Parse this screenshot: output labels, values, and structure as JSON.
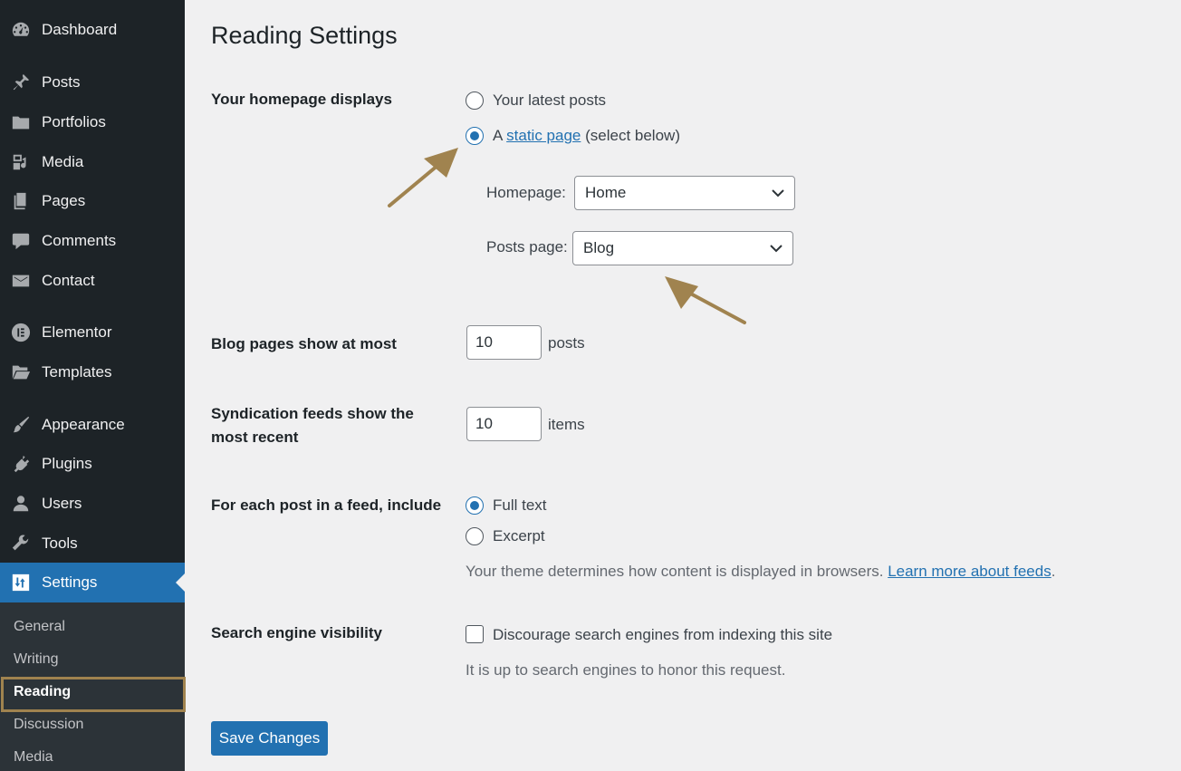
{
  "sidebar": {
    "items": [
      {
        "label": "Dashboard",
        "icon": "dashboard-icon"
      },
      {
        "label": "Posts",
        "icon": "pushpin-icon"
      },
      {
        "label": "Portfolios",
        "icon": "folder-icon"
      },
      {
        "label": "Media",
        "icon": "media-icon"
      },
      {
        "label": "Pages",
        "icon": "pages-icon"
      },
      {
        "label": "Comments",
        "icon": "comment-icon"
      },
      {
        "label": "Contact",
        "icon": "envelope-icon"
      },
      {
        "label": "Elementor",
        "icon": "elementor-icon"
      },
      {
        "label": "Templates",
        "icon": "folder-open-icon"
      },
      {
        "label": "Appearance",
        "icon": "paintbrush-icon"
      },
      {
        "label": "Plugins",
        "icon": "plug-icon"
      },
      {
        "label": "Users",
        "icon": "user-icon"
      },
      {
        "label": "Tools",
        "icon": "wrench-icon"
      },
      {
        "label": "Settings",
        "icon": "settings-icon",
        "active": true
      }
    ],
    "submenu": [
      {
        "label": "General"
      },
      {
        "label": "Writing"
      },
      {
        "label": "Reading",
        "current": true
      },
      {
        "label": "Discussion"
      },
      {
        "label": "Media"
      }
    ]
  },
  "page": {
    "title": "Reading Settings",
    "homepage_displays": {
      "label": "Your homepage displays",
      "option_latest": "Your latest posts",
      "option_static_prefix": "A",
      "option_static_link": "static page",
      "option_static_suffix": "(select below)",
      "selected": "static",
      "homepage_label": "Homepage:",
      "homepage_value": "Home",
      "posts_page_label": "Posts page:",
      "posts_page_value": "Blog"
    },
    "blog_pages": {
      "label": "Blog pages show at most",
      "value": "10",
      "unit": "posts"
    },
    "syndication": {
      "label_line1": "Syndication feeds show the",
      "label_line2": "most recent",
      "value": "10",
      "unit": "items"
    },
    "feed_content": {
      "label": "For each post in a feed, include",
      "option_full": "Full text",
      "option_excerpt": "Excerpt",
      "selected": "full",
      "description": "Your theme determines how content is displayed in browsers.",
      "link": "Learn more about feeds",
      "link_suffix": "."
    },
    "search_visibility": {
      "label": "Search engine visibility",
      "checkbox_label": "Discourage search engines from indexing this site",
      "checked": false,
      "description": "It is up to search engines to honor this request."
    },
    "save_label": "Save Changes"
  },
  "colors": {
    "sidebar_bg": "#1d2327",
    "submenu_bg": "#2c3338",
    "accent": "#2271b1",
    "annotation": "#a0834f",
    "page_bg": "#f0f0f1"
  }
}
